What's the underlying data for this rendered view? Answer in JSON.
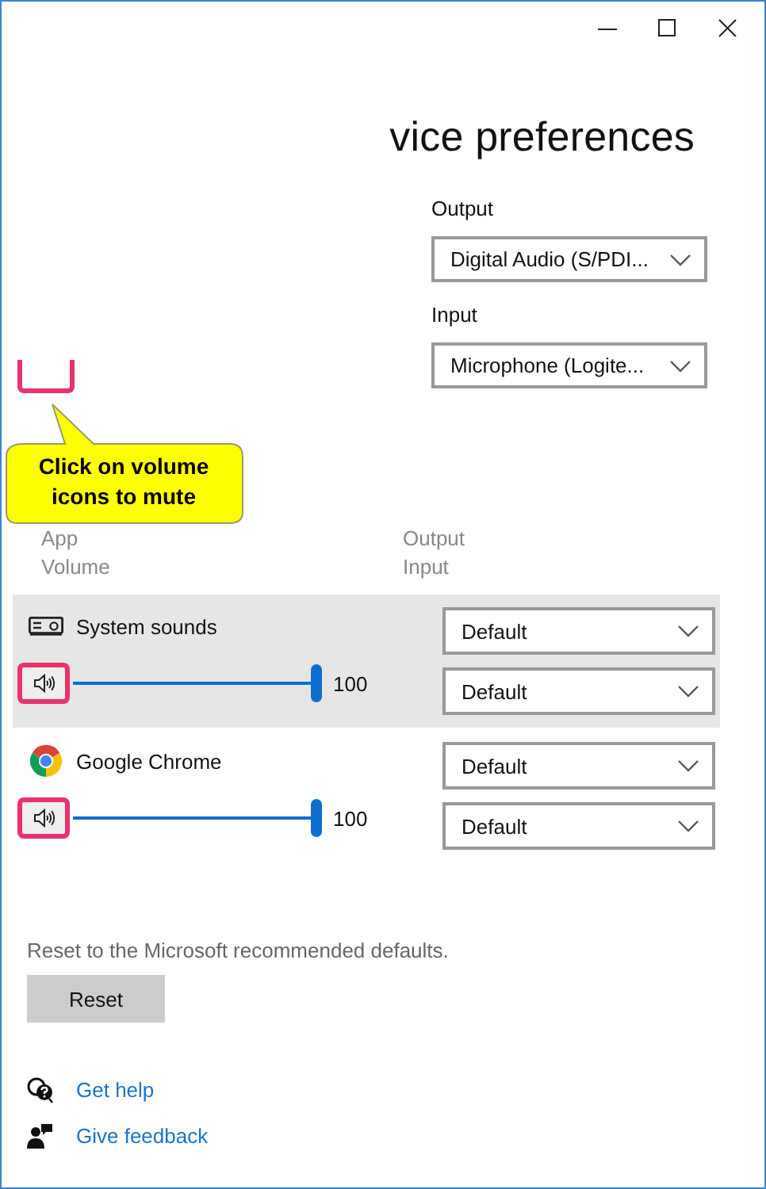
{
  "window": {
    "title": "vice preferences"
  },
  "master": {
    "output_label": "Output",
    "output_device": "Digital Audio (S/PDI...",
    "input_label": "Input",
    "input_device": "Microphone (Logite..."
  },
  "callout": {
    "text": "Click on volume icons to mute"
  },
  "apps_header": {
    "app": "App",
    "volume": "Volume",
    "output": "Output",
    "input": "Input"
  },
  "apps": [
    {
      "kind": "system",
      "name": "System sounds",
      "selected": true,
      "muted": false,
      "level": 1,
      "reading": "100",
      "output": "Default",
      "input": "Default"
    },
    {
      "kind": "chrome",
      "name": "Google Chrome",
      "selected": false,
      "muted": false,
      "level": 1,
      "reading": "100",
      "output": "Default",
      "input": "Default"
    }
  ],
  "reset": {
    "text": "Reset to the Microsoft recommended defaults.",
    "button": "Reset"
  },
  "links": [
    {
      "kind": "help",
      "label": "Get help"
    },
    {
      "kind": "feedback",
      "label": "Give feedback"
    }
  ]
}
